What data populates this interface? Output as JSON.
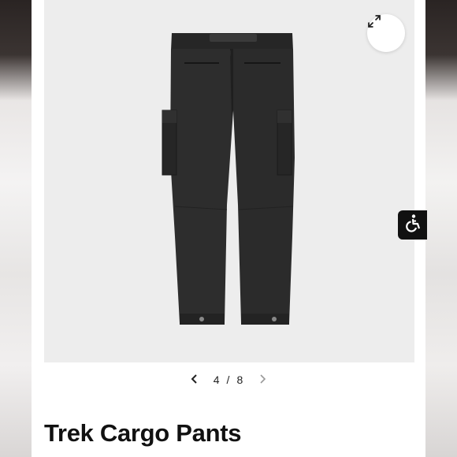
{
  "product": {
    "title": "Trek Cargo Pants"
  },
  "gallery": {
    "current": "4",
    "separator": "/",
    "total": "8",
    "prev_icon": "chevron-left-icon",
    "next_icon": "chevron-right-icon",
    "expand_icon": "expand-arrows-icon"
  },
  "accessibility": {
    "icon": "wheelchair-icon"
  },
  "colors": {
    "image_bg": "#ededed",
    "pants": "#2b2b2b",
    "accent": "#111111"
  }
}
